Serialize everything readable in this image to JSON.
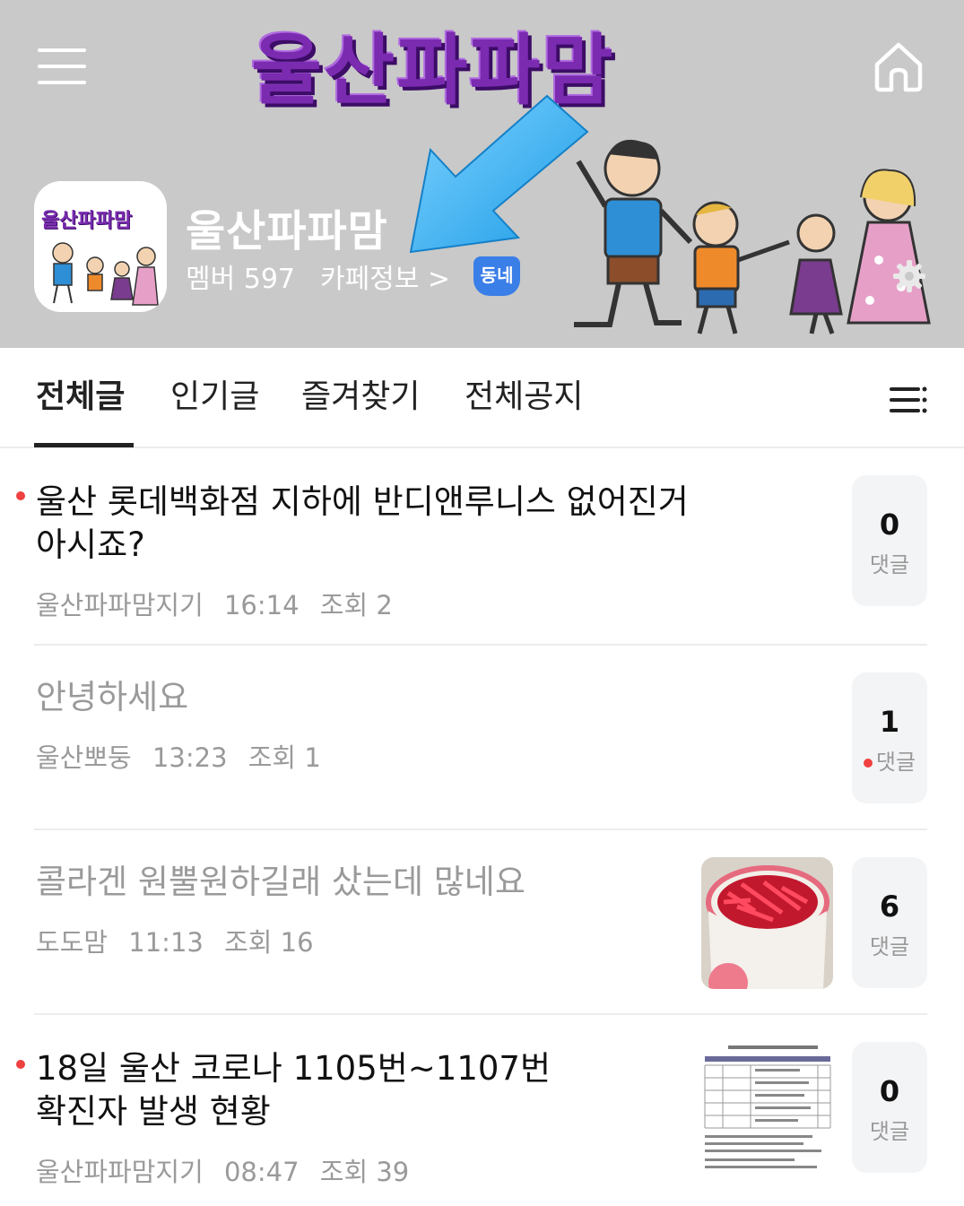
{
  "header": {
    "banner_title": "울산파파맘",
    "logo_text": "울산파파맘",
    "cafe_name": "울산파파맘",
    "members_text": "멤버 597",
    "cafe_info_link": "카페정보 >",
    "badge": "동네",
    "icons": [
      "hamburger-menu-icon",
      "home-icon",
      "settings-gear-icon"
    ]
  },
  "tabs": {
    "items": [
      {
        "label": "전체글",
        "active": true
      },
      {
        "label": "인기글",
        "active": false
      },
      {
        "label": "즐겨찾기",
        "active": false
      },
      {
        "label": "전체공지",
        "active": false
      }
    ]
  },
  "posts": [
    {
      "title_line1": "울산 롯데백화점 지하에 반디앤루니스 없어진거",
      "title_line2": "아시죠?",
      "author": "울산파파맘지기",
      "time": "16:14",
      "views": "조회 2",
      "comments": "0",
      "comment_label": "댓글",
      "new": true,
      "has_thumbnail": false
    },
    {
      "title_line1": "안녕하세요",
      "author": "울산뽀둥",
      "time": "13:23",
      "views": "조회 1",
      "comments": "1",
      "comment_label": "댓글",
      "new": false,
      "new_comment": true,
      "has_thumbnail": false
    },
    {
      "title_line1": "콜라겐 원뿔원하길래 샀는데 많네요",
      "author": "도도맘",
      "time": "11:13",
      "views": "조회 16",
      "comments": "6",
      "comment_label": "댓글",
      "new": false,
      "has_thumbnail": true
    },
    {
      "title_line1": "18일 울산 코로나 1105번~1107번",
      "title_line2": "확진자 발생 현황",
      "author": "울산파파맘지기",
      "time": "08:47",
      "views": "조회 39",
      "comments": "0",
      "comment_label": "댓글",
      "new": true,
      "has_thumbnail": true
    }
  ]
}
